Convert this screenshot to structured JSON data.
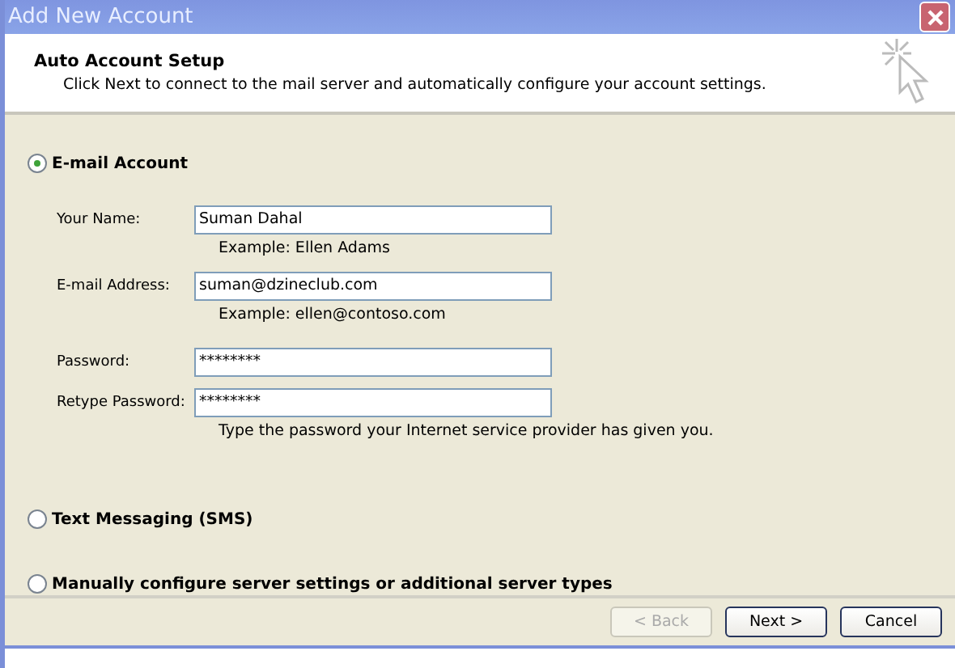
{
  "window": {
    "title": "Add New Account"
  },
  "header": {
    "title": "Auto Account Setup",
    "subtitle": "Click Next to connect to the mail server and automatically configure your account settings."
  },
  "options": [
    {
      "label": "E-mail Account",
      "selected": true,
      "fields": [
        {
          "label": "Your Name:",
          "value": "Suman Dahal",
          "hint": "Example: Ellen Adams"
        },
        {
          "label": "E-mail Address:",
          "value": "suman@dzineclub.com",
          "hint": "Example: ellen@contoso.com"
        },
        {
          "label": "Password:",
          "value": "********"
        },
        {
          "label": "Retype Password:",
          "value": "********",
          "hint": "Type the password your Internet service provider has given you."
        }
      ]
    },
    {
      "label": "Text Messaging (SMS)",
      "selected": false
    },
    {
      "label": "Manually configure server settings or additional server types",
      "selected": false
    }
  ],
  "buttons": [
    {
      "label": "< Back",
      "disabled": true
    },
    {
      "label": "Next >",
      "disabled": false
    },
    {
      "label": "Cancel",
      "disabled": false
    }
  ]
}
